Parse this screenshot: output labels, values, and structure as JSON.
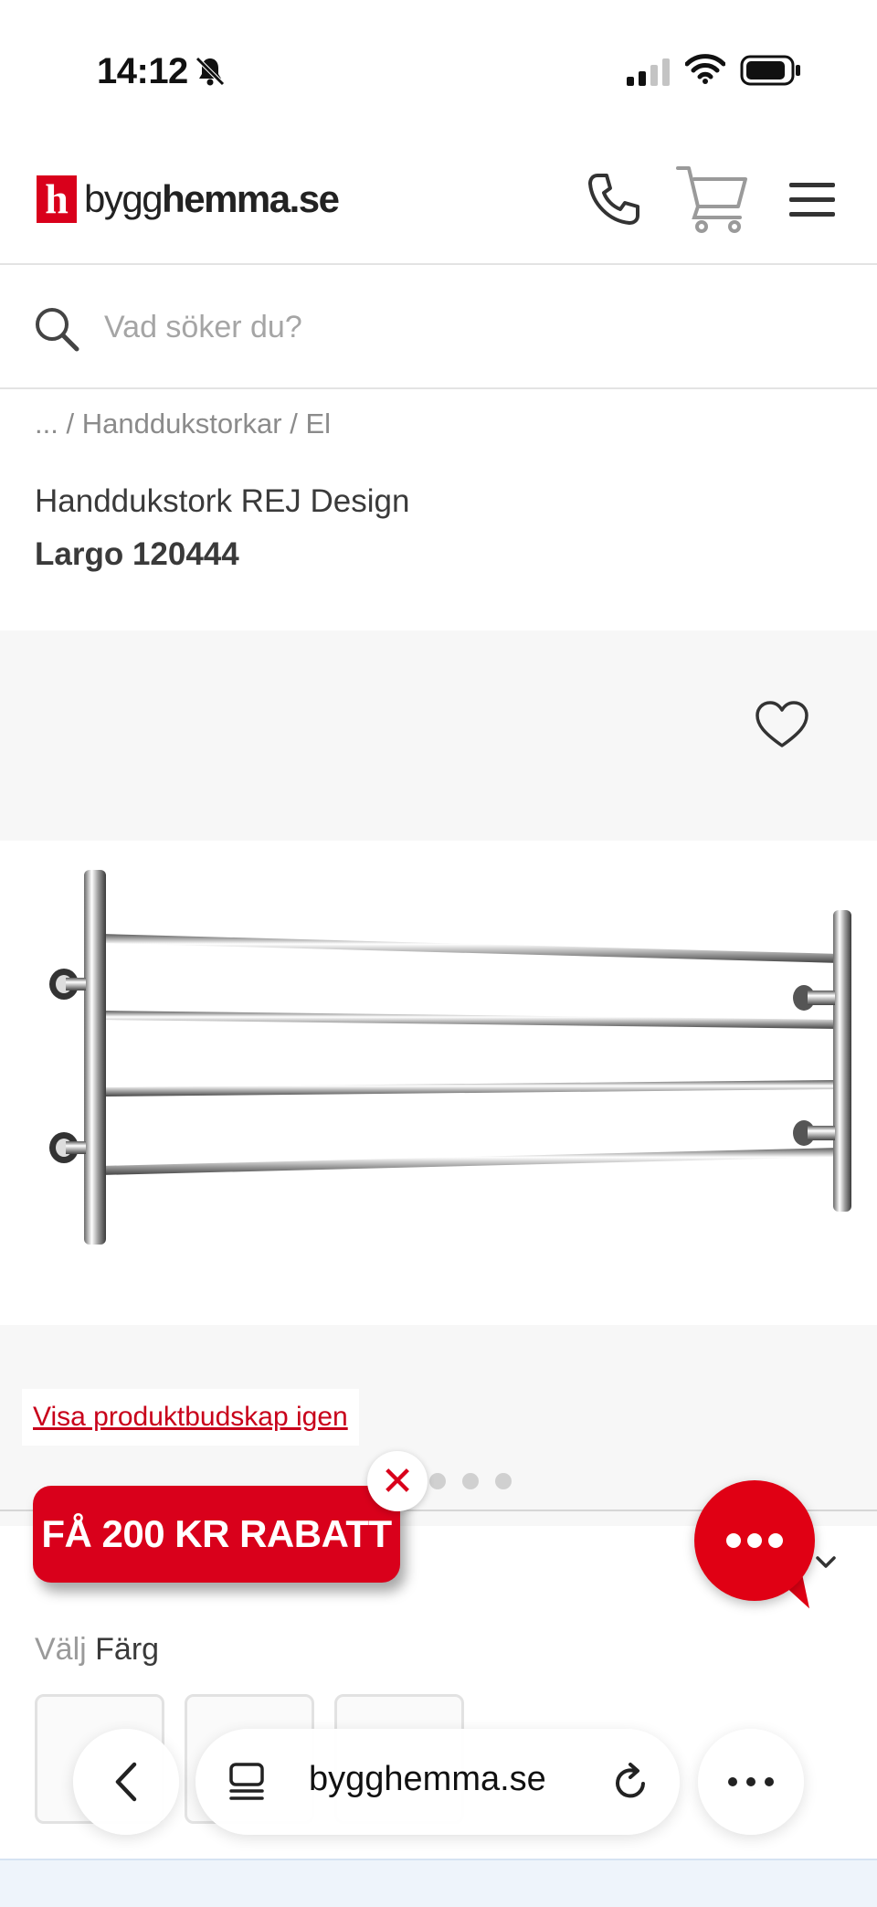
{
  "status_bar": {
    "time": "14:12",
    "icons": [
      "bell-slash-icon",
      "signal-icon",
      "wifi-icon",
      "battery-icon"
    ]
  },
  "header": {
    "logo_mark": "h",
    "logo_text_regular": "bygg",
    "logo_text_bold": "hemma.se",
    "icons": [
      "phone-icon",
      "cart-icon",
      "menu-icon"
    ],
    "brand_color": "#d9001b"
  },
  "search": {
    "placeholder": "Vad söker du?",
    "value": ""
  },
  "breadcrumb": {
    "ellipsis": "...",
    "separator": "/",
    "items": [
      "Handdukstorkar",
      "El"
    ]
  },
  "product": {
    "title_line1": "Handdukstork REJ Design",
    "title_line2": "Largo 120444"
  },
  "gallery": {
    "favorite_icon": "heart-icon",
    "show_message_link": "Visa produktbudskap igen",
    "slide_count": 3
  },
  "promo": {
    "label": "FÅ 200 KR RABATT",
    "close_label": "✕"
  },
  "options": {
    "choose_label": "Välj",
    "attribute": "Färg",
    "swatch_count": 3
  },
  "browser": {
    "url": "bygghemma.se",
    "icons": [
      "back-icon",
      "tabs-icon",
      "reload-icon",
      "more-icon"
    ]
  }
}
